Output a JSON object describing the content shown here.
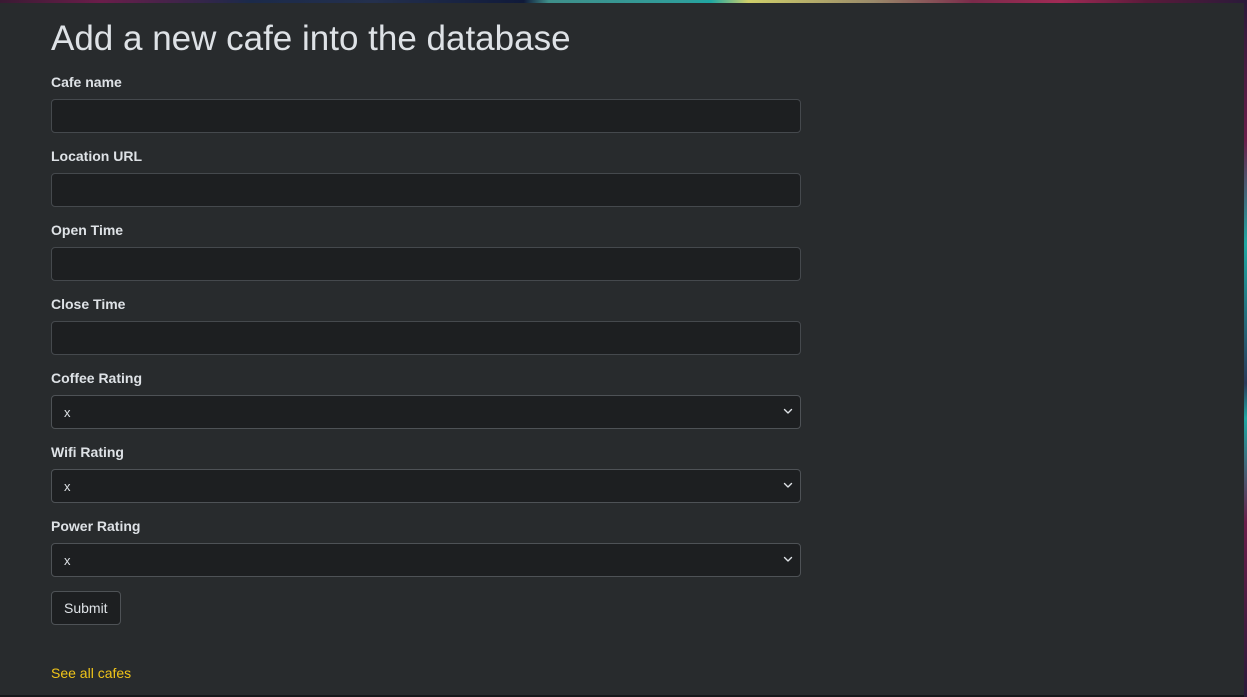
{
  "page": {
    "title": "Add a new cafe into the database"
  },
  "form": {
    "cafe_name": {
      "label": "Cafe name",
      "value": ""
    },
    "location_url": {
      "label": "Location URL",
      "value": ""
    },
    "open_time": {
      "label": "Open Time",
      "value": ""
    },
    "close_time": {
      "label": "Close Time",
      "value": ""
    },
    "coffee_rating": {
      "label": "Coffee Rating",
      "selected": "x"
    },
    "wifi_rating": {
      "label": "Wifi Rating",
      "selected": "x"
    },
    "power_rating": {
      "label": "Power Rating",
      "selected": "x"
    },
    "submit_label": "Submit"
  },
  "footer": {
    "see_all_link": "See all cafes"
  },
  "colors": {
    "background": "#282b2d",
    "input_background": "#1d1f21",
    "text": "#dee2e6",
    "link": "#f0c419"
  },
  "icons": {
    "select_arrow": "chevron-down-icon"
  }
}
